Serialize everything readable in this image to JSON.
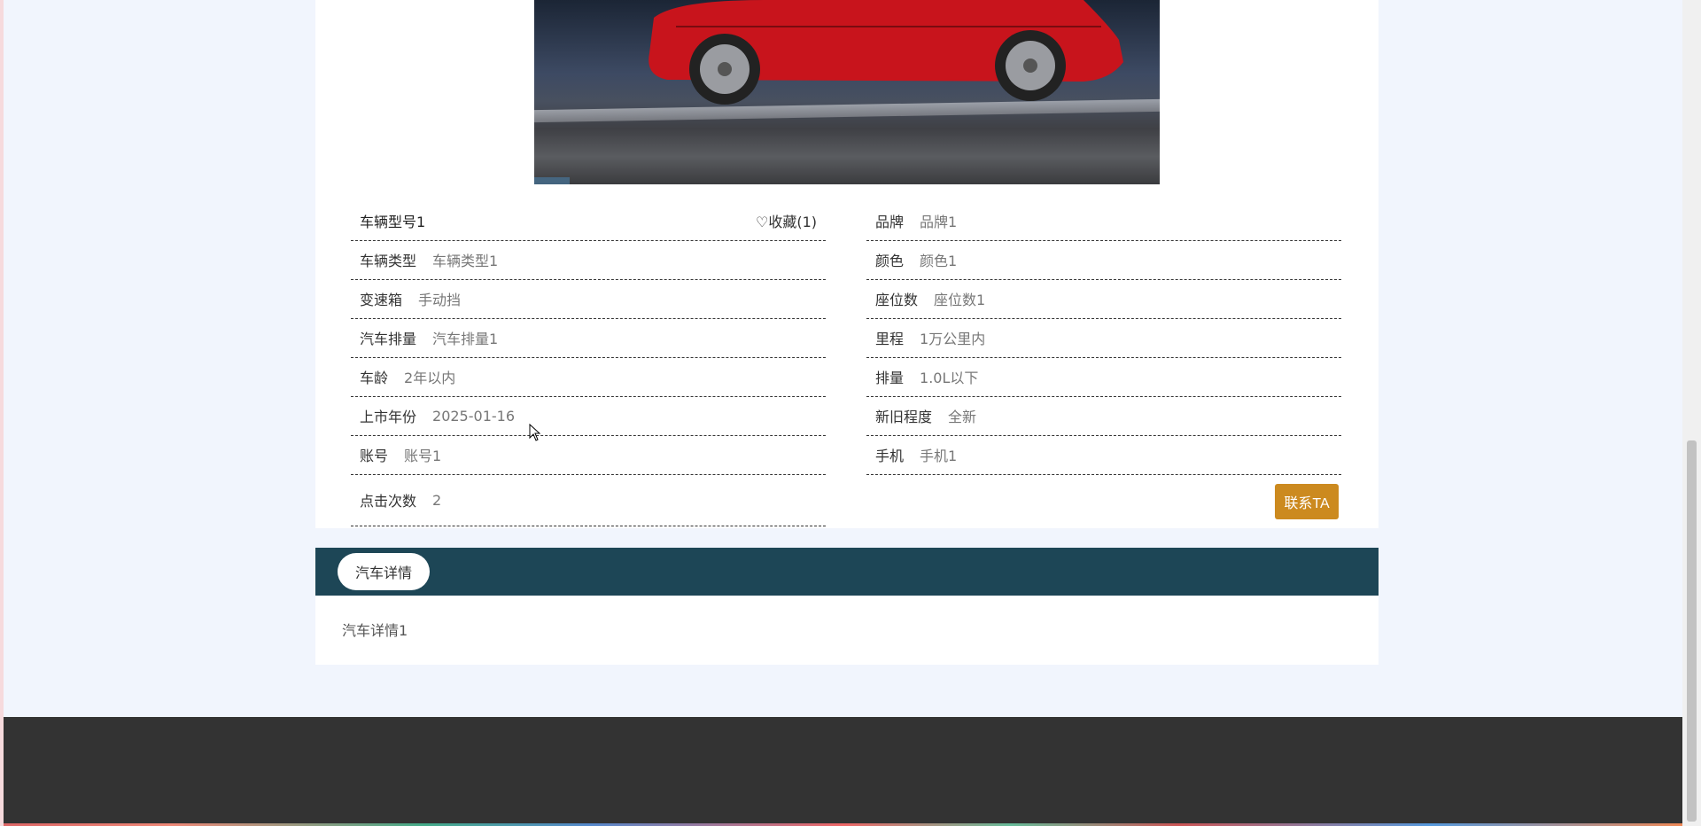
{
  "car": {
    "model": "车辆型号1",
    "favorite": "♡收藏(1)"
  },
  "left_fields": [
    {
      "label": "车辆类型",
      "value": "车辆类型1"
    },
    {
      "label": "变速箱",
      "value": "手动挡"
    },
    {
      "label": "汽车排量",
      "value": "汽车排量1"
    },
    {
      "label": "车龄",
      "value": "2年以内"
    },
    {
      "label": "上市年份",
      "value": "2025-01-16"
    },
    {
      "label": "账号",
      "value": "账号1"
    },
    {
      "label": "点击次数",
      "value": "2"
    }
  ],
  "right_fields": [
    {
      "label": "品牌",
      "value": "品牌1"
    },
    {
      "label": "颜色",
      "value": "颜色1"
    },
    {
      "label": "座位数",
      "value": "座位数1"
    },
    {
      "label": "里程",
      "value": "1万公里内"
    },
    {
      "label": "排量",
      "value": "1.0L以下"
    },
    {
      "label": "新旧程度",
      "value": "全新"
    },
    {
      "label": "手机",
      "value": "手机1"
    }
  ],
  "contact_button": "联系TA",
  "tabs": [
    {
      "label": "汽车详情"
    }
  ],
  "detail_text": "汽车详情1",
  "colors": {
    "accent_button": "#cc8a1f",
    "tab_bar": "#1d4656",
    "footer": "#333333"
  }
}
